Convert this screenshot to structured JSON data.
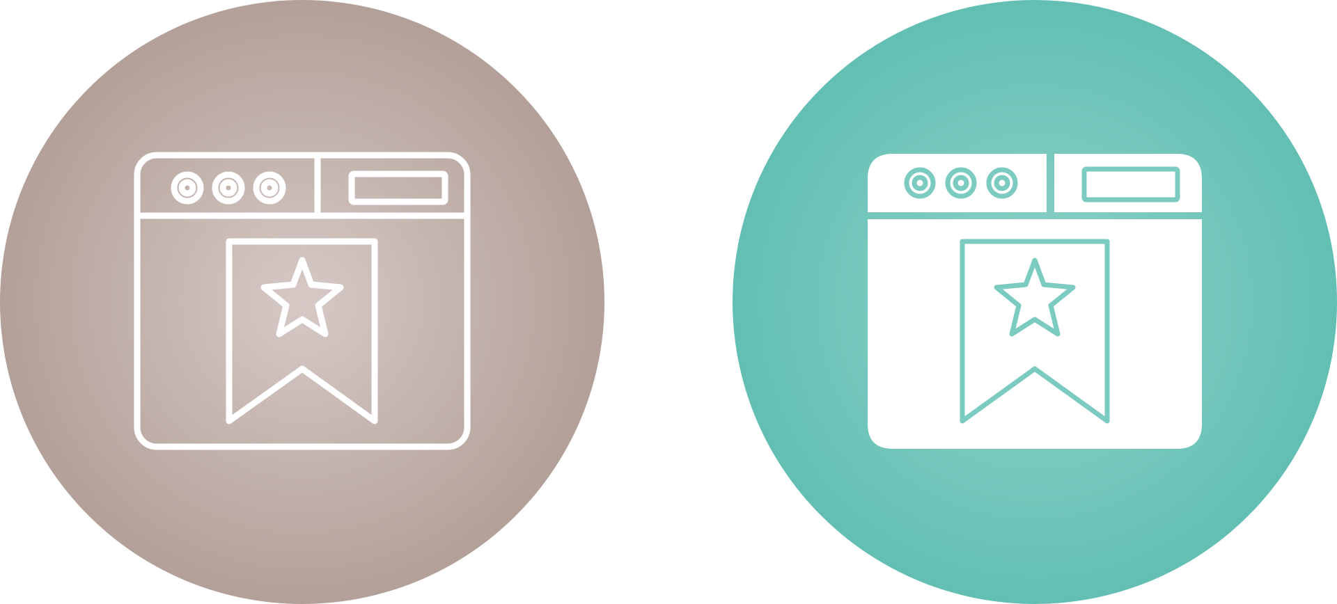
{
  "icons": [
    {
      "name": "outline-browser-bookmark-icon",
      "style": "outline",
      "circle_outer_color": "#b3a098",
      "circle_inner_color": "#d6c9c6",
      "glyph_color": "#ffffff"
    },
    {
      "name": "filled-browser-bookmark-icon",
      "style": "filled",
      "circle_outer_color": "#63bfb3",
      "circle_inner_color": "#8fd2c9",
      "glyph_color": "#ffffff",
      "detail_color": "#7ccbc1"
    }
  ]
}
